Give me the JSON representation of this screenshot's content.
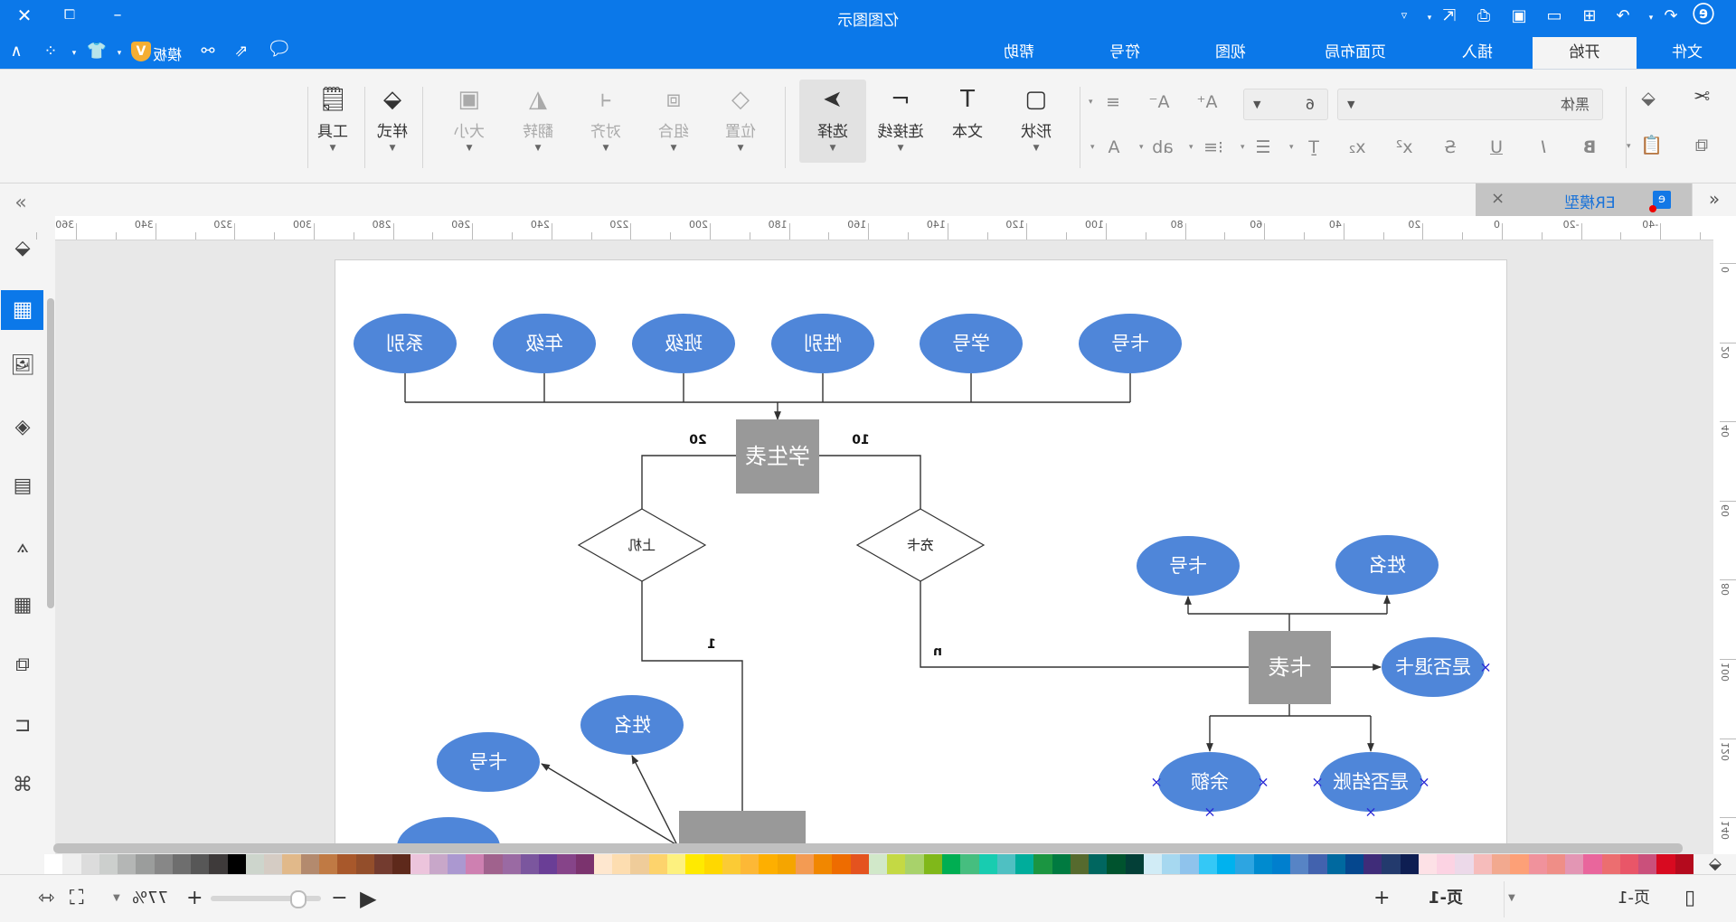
{
  "window": {
    "title": "亿图图示"
  },
  "menu_tabs": [
    {
      "label": "文件",
      "active": false
    },
    {
      "label": "开始",
      "active": true
    },
    {
      "label": "插入",
      "active": false
    },
    {
      "label": "页面布局",
      "active": false
    },
    {
      "label": "视图",
      "active": false
    },
    {
      "label": "符号",
      "active": false
    },
    {
      "label": "帮助",
      "active": false
    }
  ],
  "quick_bar": {
    "template_label": "模板"
  },
  "ribbon": {
    "font_name": "黑体",
    "font_size": "6",
    "shape": "形状",
    "text": "文本",
    "connector": "连接线",
    "select": "选择",
    "position": "位置",
    "group": "组合",
    "align": "对齐",
    "flip": "翻转",
    "size": "大小",
    "style": "样式",
    "tools": "工具",
    "bold": "B",
    "italic": "I",
    "underline": "U",
    "strike": "S",
    "superscript": "x²",
    "subscript": "x₂",
    "text_color": "A",
    "highlight": "ab",
    "grow_font": "A⁺",
    "shrink_font": "A⁻"
  },
  "doc_tab": {
    "title": "ER模型"
  },
  "ruler": {
    "top": [
      "-40",
      "-20",
      "0",
      "20",
      "40",
      "60",
      "80",
      "100",
      "120",
      "140",
      "160",
      "180",
      "200",
      "220",
      "240",
      "260",
      "280",
      "300",
      "320",
      "340",
      "360"
    ],
    "left": [
      "0",
      "20",
      "40",
      "60",
      "80",
      "100",
      "120",
      "140"
    ]
  },
  "diagram": {
    "student_table": "学生表",
    "student_attributes": [
      "系别",
      "年级",
      "班级",
      "性别",
      "学号",
      "卡号"
    ],
    "relation_left": "上机",
    "relation_right": "充卡",
    "card_labels": {
      "left_top": "20",
      "right_top": "10",
      "left_bottom": "1",
      "right_bottom": "n"
    },
    "card_table": "卡表",
    "card_attributes": {
      "card_no": "卡号",
      "name": "姓名",
      "refunded": "是否退卡",
      "balance": "余额",
      "settled": "是否结账"
    },
    "session_attributes": {
      "name": "姓名",
      "card_no": "卡号"
    },
    "colors": {
      "entity_fill": "#999999",
      "attribute_fill": "#4f86d9",
      "line": "#333333",
      "marker": "#2b2bd6"
    }
  },
  "palette": [
    "#ffffff",
    "#efefef",
    "#dcdcdc",
    "#cccfcd",
    "#b4b6b5",
    "#9b9d9c",
    "#878787",
    "#6e6e6e",
    "#575757",
    "#3e3a3a",
    "#000000",
    "#cdd5cc",
    "#d5ccc4",
    "#e1b98a",
    "#b38a6e",
    "#c07a44",
    "#a8582b",
    "#934e2b",
    "#733b2f",
    "#5e291b",
    "#ecc4dc",
    "#c8a7c9",
    "#ab98d0",
    "#ce80b1",
    "#a0628d",
    "#9a6aa3",
    "#7b569e",
    "#6a3e96",
    "#864489",
    "#7b336e",
    "#fee7cf",
    "#fdddb0",
    "#efcc9a",
    "#fdd36c",
    "#fdf17f",
    "#ffea00",
    "#ffd800",
    "#fbcb35",
    "#fdb836",
    "#feaf00",
    "#f5a500",
    "#f39b53",
    "#f18700",
    "#ee6c00",
    "#e4531f",
    "#d1e8c9",
    "#c4d944",
    "#a8d26b",
    "#80b81a",
    "#00ae52",
    "#46be7f",
    "#18ccb0",
    "#4fc0c2",
    "#00ad9b",
    "#1b9541",
    "#007a40",
    "#566a2e",
    "#00665f",
    "#00532e",
    "#033f37",
    "#d1ecf6",
    "#a6d8f0",
    "#8fc3ec",
    "#34c8f6",
    "#00b2ee",
    "#2da5e1",
    "#008bcf",
    "#007fce",
    "#5784c5",
    "#4262ae",
    "#00699f",
    "#05478e",
    "#3f2c79",
    "#233a6d",
    "#0e1e52",
    "#fde1e6",
    "#fcd3e3",
    "#ecd9e9",
    "#f6bcbb",
    "#f2a98f",
    "#fda077",
    "#f0929c",
    "#ef8e87",
    "#e396b4",
    "#e9669c",
    "#ec6e70",
    "#e95668",
    "#ca507b",
    "#d80a20",
    "#b40a1d"
  ],
  "status": {
    "page_selector": "页-1",
    "page_tab": "页-1",
    "add_page": "+",
    "zoom": "77%",
    "zoom_in": "+",
    "zoom_out": "−"
  },
  "accent_color": "#0b78e9"
}
